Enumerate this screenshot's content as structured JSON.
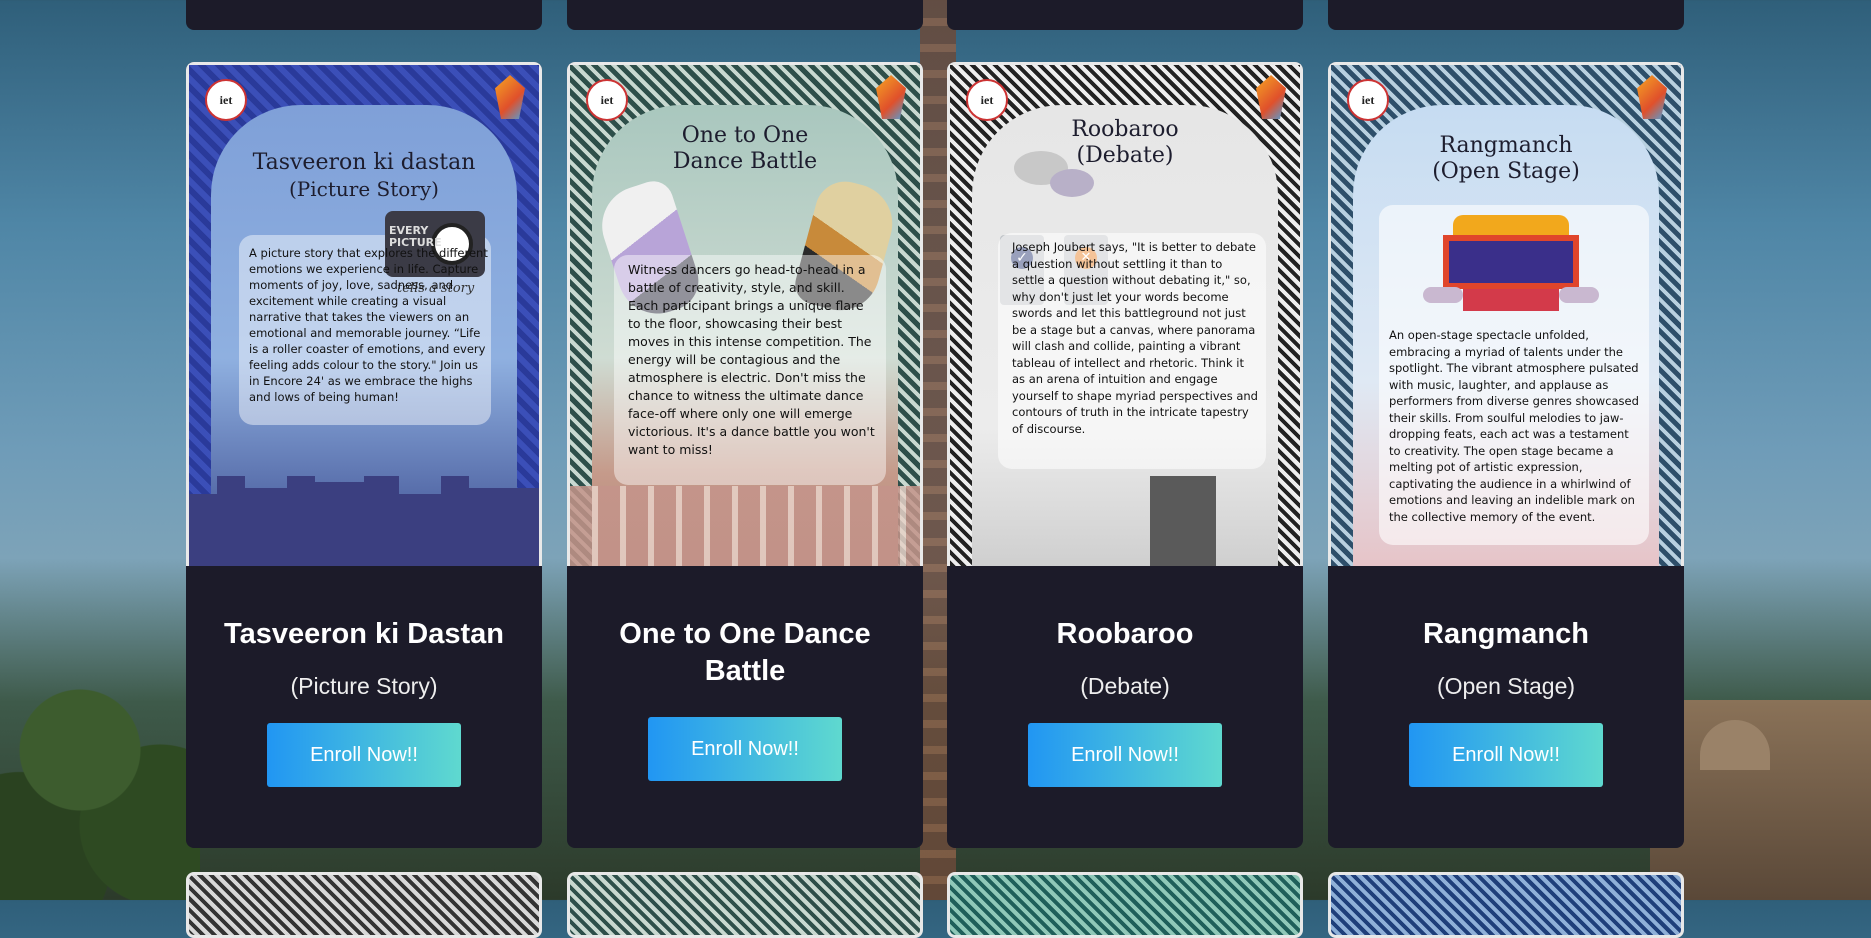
{
  "colors": {
    "card_bg": "#1c1b29",
    "button_gradient_start": "#2196f3",
    "button_gradient_end": "#5fd9cf",
    "title_text": "#ffffff"
  },
  "events": [
    {
      "title": "Tasveeron ki Dastan",
      "subtitle": "(Picture Story)",
      "button": "Enroll Now!!",
      "poster": {
        "logo": "iet",
        "title_line1": "Tasveeron ki dastan",
        "title_line2": "(Picture Story)",
        "graphic_line1": "EVERY",
        "graphic_line2": "PICTURE",
        "graphic_script": "tells a story",
        "body": "A picture story that explores the different emotions we experience in life. Capture moments of joy, love, sadness, and excitement while creating a visual narrative that takes the viewers on an emotional and memorable journey. “Life is a roller coaster of emotions, and every feeling adds colour to the story.\" Join us in Encore 24' as we embrace the highs and lows of being human!"
      }
    },
    {
      "title": "One to One Dance Battle",
      "subtitle": "",
      "button": "Enroll Now!!",
      "poster": {
        "logo": "iet",
        "title_line1": "One to One",
        "title_line2": "Dance Battle",
        "body": "Witness dancers go head-to-head in a battle of creativity, style, and skill. Each participant brings a unique flare to the floor, showcasing their best moves in this intense competition. The energy will be contagious and the atmosphere is electric. Don't miss the chance to witness the ultimate dance face-off where only one will emerge victorious. It's a dance battle you won't want to miss!"
      }
    },
    {
      "title": "Roobaroo",
      "subtitle": "(Debate)",
      "button": "Enroll Now!!",
      "poster": {
        "logo": "iet",
        "title_line1": "Roobaroo",
        "title_line2": "(Debate)",
        "body": "Joseph Joubert says, \"It is better to debate a question without settling it than to settle a question without debating it,\" so, why don't just let your words become swords and let this battleground not just be a stage but a canvas, where panorama will clash and collide, painting a vibrant tableau of intellect and rhetoric. Think it as an arena of intuition and engage yourself to shape myriad perspectives and contours of truth in the intricate tapestry of discourse."
      }
    },
    {
      "title": "Rangmanch",
      "subtitle": "(Open Stage)",
      "button": "Enroll Now!!",
      "poster": {
        "logo": "iet",
        "title_line1": "Rangmanch",
        "title_line2": "(Open Stage)",
        "body": "An open-stage spectacle unfolded, embracing a myriad of talents under the spotlight. The vibrant atmosphere pulsated with music, laughter, and applause as performers from diverse genres showcased their skills. From soulful melodies to jaw-dropping feats, each act was a testament to creativity. The open stage became a melting pot of artistic expression, captivating the audience in a whirlwind of emotions and leaving an indelible mark on the collective memory of the event."
      }
    }
  ]
}
